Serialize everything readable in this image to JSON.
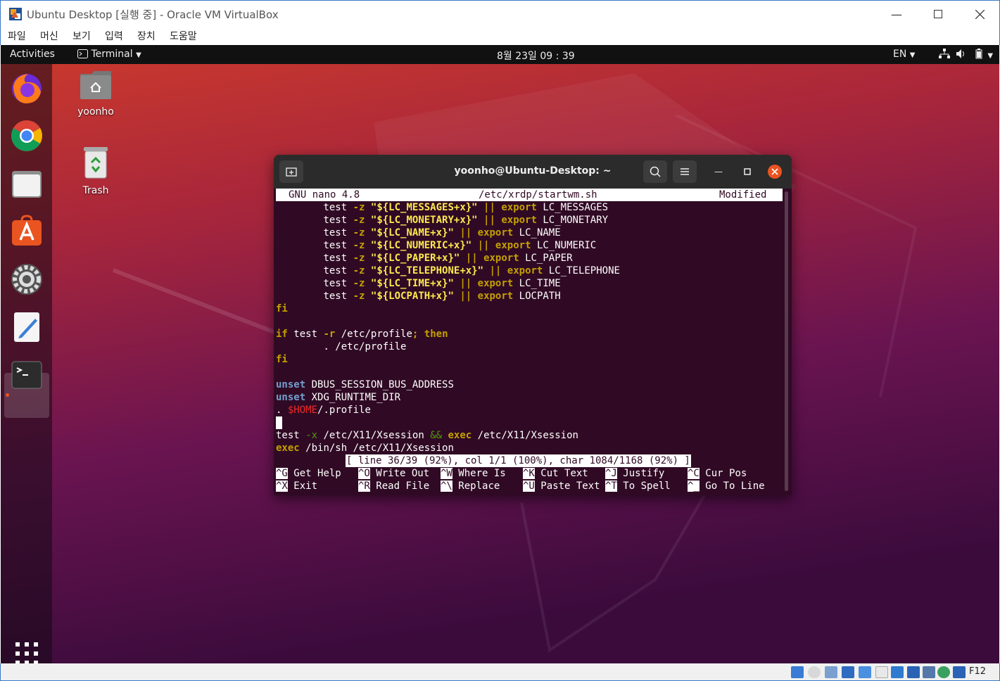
{
  "vbox": {
    "title": "Ubuntu Desktop [실행 중] - Oracle VM VirtualBox",
    "menu": [
      "파일",
      "머신",
      "보기",
      "입력",
      "장치",
      "도움말"
    ],
    "host_key": "F12"
  },
  "topbar": {
    "activities": "Activities",
    "app_menu": "Terminal",
    "clock": "8월 23일  09 : 39",
    "input_lang": "EN"
  },
  "desktop": {
    "home_label": "yoonho",
    "trash_label": "Trash"
  },
  "terminal": {
    "title": "yoonho@Ubuntu-Desktop: ~",
    "nano_version": "GNU nano 4.8",
    "file_path": "/etc/xrdp/startwm.sh",
    "modified": "Modified",
    "env_vars": [
      {
        "var": "\"${LC_MESSAGES+x}\"",
        "name": "LC_MESSAGES"
      },
      {
        "var": "\"${LC_MONETARY+x}\"",
        "name": "LC_MONETARY"
      },
      {
        "var": "\"${LC_NAME+x}\"",
        "name": "LC_NAME"
      },
      {
        "var": "\"${LC_NUMERIC+x}\"",
        "name": "LC_NUMERIC"
      },
      {
        "var": "\"${LC_PAPER+x}\"",
        "name": "LC_PAPER"
      },
      {
        "var": "\"${LC_TELEPHONE+x}\"",
        "name": "LC_TELEPHONE"
      },
      {
        "var": "\"${LC_TIME+x}\"",
        "name": "LC_TIME"
      },
      {
        "var": "\"${LOCPATH+x}\"",
        "name": "LOCPATH"
      }
    ],
    "tokens": {
      "test": "test",
      "opt_z": "-z",
      "opt_r": "-r",
      "opt_x": "-x",
      "or": "||",
      "and": "&&",
      "export": "export",
      "fi": "fi",
      "if": "if",
      "then": "then",
      "unset": "unset",
      "exec": "exec",
      "semicolon": ";",
      "dot": ".",
      "home_var": "$HOME"
    },
    "code": {
      "etc_profile": "/etc/profile",
      "source_profile": ". /etc/profile",
      "dbus": "DBUS_SESSION_BUS_ADDRESS",
      "xdg": "XDG_RUNTIME_DIR",
      "profile_suffix": "/.profile",
      "xsession": "/etc/X11/Xsession",
      "bin_sh": "/bin/sh"
    },
    "status_message": "[ line 36/39 (92%), col 1/1 (100%), char 1084/1168 (92%) ]",
    "shortcuts_row1": [
      {
        "key": "^G",
        "label": "Get Help"
      },
      {
        "key": "^O",
        "label": "Write Out"
      },
      {
        "key": "^W",
        "label": "Where Is"
      },
      {
        "key": "^K",
        "label": "Cut Text"
      },
      {
        "key": "^J",
        "label": "Justify"
      },
      {
        "key": "^C",
        "label": "Cur Pos"
      }
    ],
    "shortcuts_row2": [
      {
        "key": "^X",
        "label": "Exit"
      },
      {
        "key": "^R",
        "label": "Read File"
      },
      {
        "key": "^\\",
        "label": "Replace"
      },
      {
        "key": "^U",
        "label": "Paste Text"
      },
      {
        "key": "^T",
        "label": "To Spell"
      },
      {
        "key": "^_",
        "label": "Go To Line"
      }
    ]
  },
  "colors": {
    "terminal_bg": "#300a24",
    "keyword": "#c4a000",
    "string": "#fce94f",
    "operator": "#4e9a06",
    "builtin": "#729fcf",
    "variable": "#ef2929",
    "ubuntu_orange": "#e95420"
  }
}
